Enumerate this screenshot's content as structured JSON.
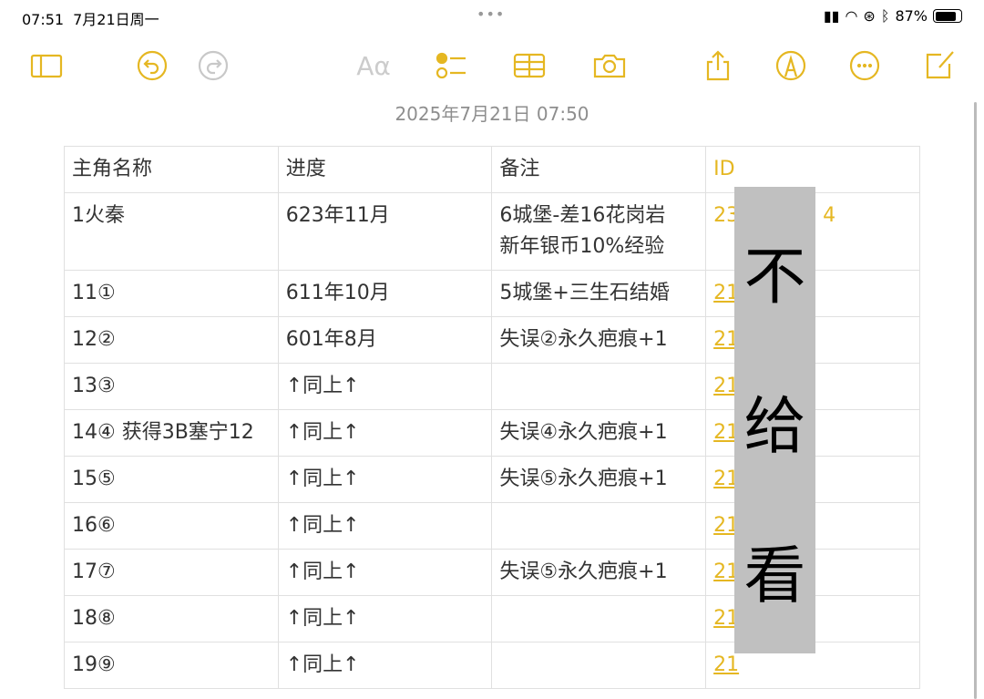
{
  "status": {
    "time": "07:51",
    "date": "7月21日周一",
    "battery": "87%",
    "battery_level": 0.87
  },
  "toolbar": {
    "text_format": "Aα"
  },
  "note": {
    "timestamp": "2025年7月21日 07:50"
  },
  "table": {
    "headers": [
      "主角名称",
      "进度",
      "备注",
      "ID"
    ],
    "rows": [
      {
        "name": "1火秦",
        "progress": "623年11月",
        "note": "6城堡-差16花岗岩\n新年银币10%经验",
        "id": "23",
        "id_tail": "4"
      },
      {
        "name": "11①",
        "progress": "611年10月",
        "note": "5城堡+三生石结婚",
        "id": "21"
      },
      {
        "name": "12②",
        "progress": "601年8月",
        "note": "失误②永久疤痕+1",
        "id": "21"
      },
      {
        "name": "13③",
        "progress": "↑同上↑",
        "note": "",
        "id": "21"
      },
      {
        "name": "14④ 获得3B塞宁12",
        "progress": "↑同上↑",
        "note": "失误④永久疤痕+1",
        "id": "21"
      },
      {
        "name": "15⑤",
        "progress": "↑同上↑",
        "note": "失误⑤永久疤痕+1",
        "id": "21"
      },
      {
        "name": "16⑥",
        "progress": "↑同上↑",
        "note": "",
        "id": "21"
      },
      {
        "name": "17⑦",
        "progress": "↑同上↑",
        "note": "失误⑤永久疤痕+1",
        "id": "21"
      },
      {
        "name": "18⑧",
        "progress": "↑同上↑",
        "note": "",
        "id": "21"
      },
      {
        "name": "19⑨",
        "progress": "↑同上↑",
        "note": "",
        "id": "21"
      }
    ]
  },
  "overlay": [
    "不",
    "给",
    "看"
  ]
}
